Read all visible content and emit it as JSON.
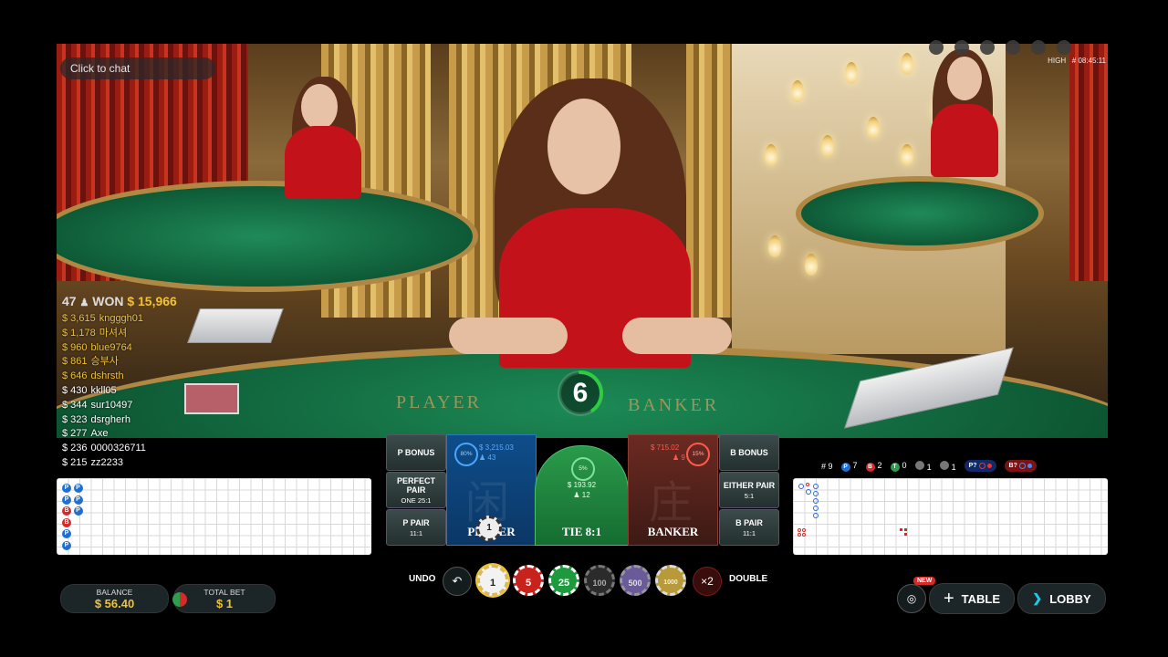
{
  "chat": {
    "placeholder": "Click to chat"
  },
  "stream": {
    "quality": "HIGH",
    "round_id": "# 08:45:11"
  },
  "table_felt": {
    "player_word": "PLAYER",
    "banker_word": "BANKER"
  },
  "winners": {
    "count": "47",
    "won_label": "WON",
    "total": "$ 15,966",
    "list": [
      {
        "amount": "$ 3,615",
        "name": "kngggh01",
        "gold": true
      },
      {
        "amount": "$ 1,178",
        "name": "마셔셔",
        "gold": true
      },
      {
        "amount": "$ 960",
        "name": "blue9764",
        "gold": true
      },
      {
        "amount": "$ 861",
        "name": "승부사",
        "gold": true
      },
      {
        "amount": "$ 646",
        "name": "dshrsth",
        "gold": true
      },
      {
        "amount": "$ 430",
        "name": "kkll05",
        "gold": false
      },
      {
        "amount": "$ 344",
        "name": "sur10497",
        "gold": false
      },
      {
        "amount": "$ 323",
        "name": "dsrgherh",
        "gold": false
      },
      {
        "amount": "$ 277",
        "name": "Axe",
        "gold": false
      },
      {
        "amount": "$ 236",
        "name": "0000326711",
        "gold": false
      },
      {
        "amount": "$ 215",
        "name": "zz2233",
        "gold": false
      }
    ]
  },
  "timer": {
    "seconds": "6",
    "fraction_remaining": 0.4
  },
  "bets": {
    "p_bonus": "P BONUS",
    "perfect_pair": "PERFECT PAIR",
    "perfect_pair_odds": "ONE 25:1",
    "p_pair": "P PAIR",
    "p_pair_odds": "11:1",
    "b_bonus": "B BONUS",
    "either_pair": "EITHER PAIR",
    "either_pair_odds": "5:1",
    "b_pair": "B PAIR",
    "b_pair_odds": "11:1",
    "player": {
      "label": "PLAYER",
      "pct": "80%",
      "amount": "$ 3,215.03",
      "players": "43",
      "chip": "1"
    },
    "tie": {
      "label": "TIE 8:1",
      "pct": "5%",
      "amount": "$ 193.92",
      "players": "12"
    },
    "banker": {
      "label": "BANKER",
      "pct": "15%",
      "amount": "$ 715.02",
      "players": "9"
    }
  },
  "stats": {
    "games": "# 9",
    "player_wins": "7",
    "banker_wins": "2",
    "ties": "0",
    "player_pairs": "1",
    "banker_pairs": "1",
    "player_predict": "P?",
    "banker_predict": "B?"
  },
  "bead_road": [
    "P",
    "P",
    "P",
    "P",
    "B",
    "P",
    "B",
    "P",
    "P"
  ],
  "controls": {
    "undo": "UNDO",
    "double": "DOUBLE",
    "double_icon": "×2",
    "chips": [
      "1",
      "5",
      "25",
      "100",
      "500",
      "1000"
    ],
    "selected_chip": "1"
  },
  "balance": {
    "label": "BALANCE",
    "value": "$ 56.40"
  },
  "total_bet": {
    "label": "TOTAL BET",
    "value": "$ 1"
  },
  "nav": {
    "new_badge": "NEW",
    "table": "TABLE",
    "lobby": "LOBBY"
  },
  "colors": {
    "player": "#1f6fd1",
    "banker": "#d42a2a",
    "tie": "#2e9e4d",
    "gold": "#f1c232"
  }
}
